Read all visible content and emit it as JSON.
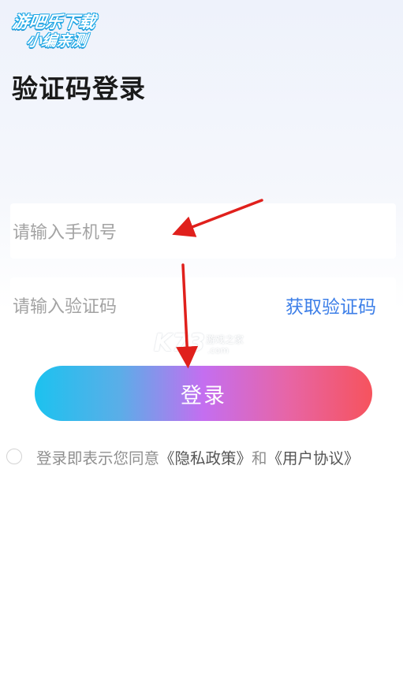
{
  "watermark": {
    "line1": "游吧乐下载",
    "line2": "小编亲测"
  },
  "page": {
    "title": "验证码登录"
  },
  "phone_input": {
    "placeholder": "请输入手机号"
  },
  "code_input": {
    "placeholder": "请输入验证码",
    "get_code_label": "获取验证码"
  },
  "login_button": {
    "label": "登录"
  },
  "overlay_logo": {
    "main": "K73",
    "cn": "游戏之家",
    "com": ".com"
  },
  "agreement": {
    "prefix": "登录即表示您同意",
    "privacy_label": "《隐私政策》",
    "and": "和",
    "user_agreement_label": "《用户协议》"
  },
  "colors": {
    "accent_link": "#3d7fe8",
    "gradient_start": "#1cc2ef",
    "gradient_mid": "#c46ef0",
    "gradient_end": "#f6535d",
    "annotation_arrow": "#e0201c"
  }
}
